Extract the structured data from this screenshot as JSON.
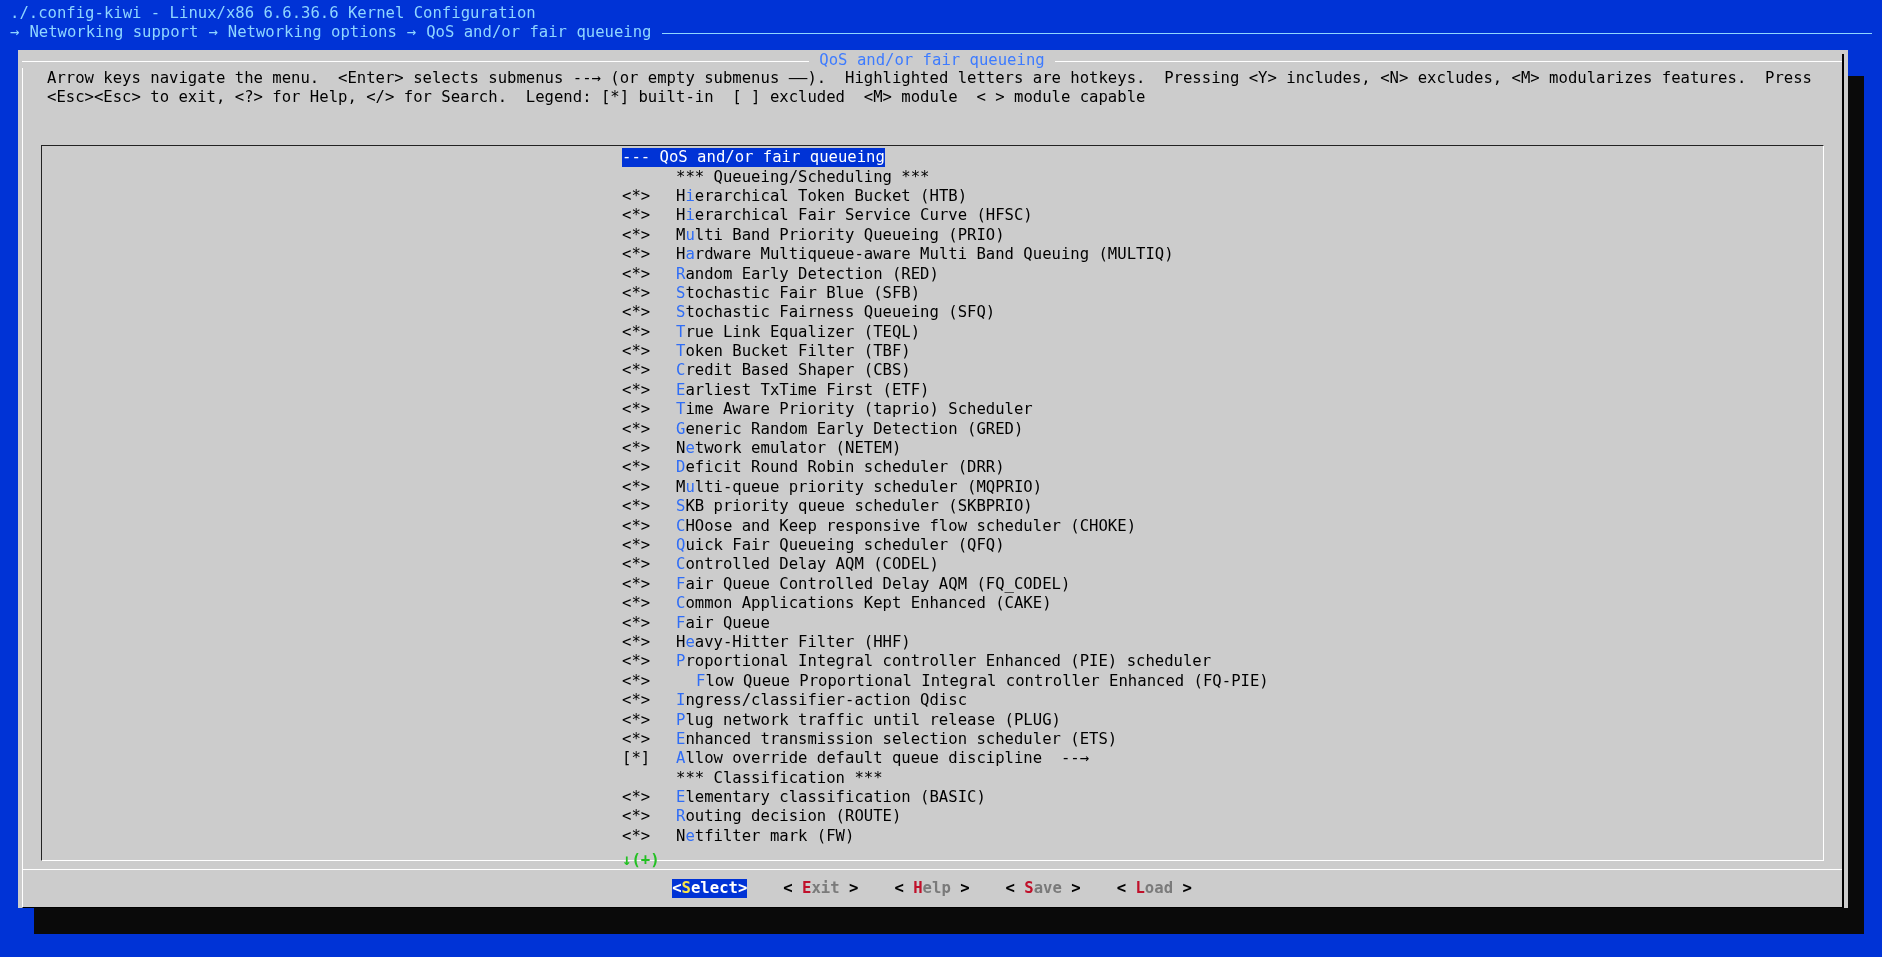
{
  "window": {
    "title": "./.config-kiwi - Linux/x86 6.6.36.6 Kernel Configuration"
  },
  "breadcrumb": {
    "separator": "→",
    "items": [
      "Networking support",
      "Networking options",
      "QoS and/or fair queueing"
    ]
  },
  "dialog": {
    "title": "QoS and/or fair queueing",
    "help": [
      "Arrow keys navigate the menu.  <Enter> selects submenus --→ (or empty submenus ——).  Highlighted letters are hotkeys.  Pressing <Y> includes, <N> excludes, <M> modularizes features.  Press",
      "<Esc><Esc> to exit, <?> for Help, </> for Search.  Legend: [*] built-in  [ ] excluded  <M> module  < > module capable"
    ],
    "items": [
      {
        "kind": "header",
        "text": "--- QoS and/or fair queueing",
        "selected": true
      },
      {
        "kind": "comment",
        "text": "*** Queueing/Scheduling ***",
        "selected": false
      },
      {
        "kind": "option",
        "status": "<*>",
        "pre": "H",
        "key": "i",
        "rest": "erarchical Token Bucket (HTB)",
        "selected": false
      },
      {
        "kind": "option",
        "status": "<*>",
        "pre": "H",
        "key": "i",
        "rest": "erarchical Fair Service Curve (HFSC)",
        "selected": false
      },
      {
        "kind": "option",
        "status": "<*>",
        "pre": "M",
        "key": "u",
        "rest": "lti Band Priority Queueing (PRIO)",
        "selected": false
      },
      {
        "kind": "option",
        "status": "<*>",
        "pre": "H",
        "key": "a",
        "rest": "rdware Multiqueue-aware Multi Band Queuing (MULTIQ)",
        "selected": false
      },
      {
        "kind": "option",
        "status": "<*>",
        "key": "R",
        "rest": "andom Early Detection (RED)",
        "selected": false
      },
      {
        "kind": "option",
        "status": "<*>",
        "key": "S",
        "rest": "tochastic Fair Blue (SFB)",
        "selected": false
      },
      {
        "kind": "option",
        "status": "<*>",
        "key": "S",
        "rest": "tochastic Fairness Queueing (SFQ)",
        "selected": false
      },
      {
        "kind": "option",
        "status": "<*>",
        "key": "T",
        "rest": "rue Link Equalizer (TEQL)",
        "selected": false
      },
      {
        "kind": "option",
        "status": "<*>",
        "key": "T",
        "rest": "oken Bucket Filter (TBF)",
        "selected": false
      },
      {
        "kind": "option",
        "status": "<*>",
        "key": "C",
        "rest": "redit Based Shaper (CBS)",
        "selected": false
      },
      {
        "kind": "option",
        "status": "<*>",
        "key": "E",
        "rest": "arliest TxTime First (ETF)",
        "selected": false
      },
      {
        "kind": "option",
        "status": "<*>",
        "key": "T",
        "rest": "ime Aware Priority (taprio) Scheduler",
        "selected": false
      },
      {
        "kind": "option",
        "status": "<*>",
        "key": "G",
        "rest": "eneric Random Early Detection (GRED)",
        "selected": false
      },
      {
        "kind": "option",
        "status": "<*>",
        "pre": "N",
        "key": "e",
        "rest": "twork emulator (NETEM)",
        "selected": false
      },
      {
        "kind": "option",
        "status": "<*>",
        "key": "D",
        "rest": "eficit Round Robin scheduler (DRR)",
        "selected": false
      },
      {
        "kind": "option",
        "status": "<*>",
        "pre": "M",
        "key": "u",
        "rest": "lti-queue priority scheduler (MQPRIO)",
        "selected": false
      },
      {
        "kind": "option",
        "status": "<*>",
        "key": "S",
        "rest": "KB priority queue scheduler (SKBPRIO)",
        "selected": false
      },
      {
        "kind": "option",
        "status": "<*>",
        "key": "C",
        "rest": "HOose and Keep responsive flow scheduler (CHOKE)",
        "selected": false
      },
      {
        "kind": "option",
        "status": "<*>",
        "key": "Q",
        "rest": "uick Fair Queueing scheduler (QFQ)",
        "selected": false
      },
      {
        "kind": "option",
        "status": "<*>",
        "key": "C",
        "rest": "ontrolled Delay AQM (CODEL)",
        "selected": false
      },
      {
        "kind": "option",
        "status": "<*>",
        "key": "F",
        "rest": "air Queue Controlled Delay AQM (FQ_CODEL)",
        "selected": false
      },
      {
        "kind": "option",
        "status": "<*>",
        "key": "C",
        "rest": "ommon Applications Kept Enhanced (CAKE)",
        "selected": false
      },
      {
        "kind": "option",
        "status": "<*>",
        "key": "F",
        "rest": "air Queue",
        "selected": false
      },
      {
        "kind": "option",
        "status": "<*>",
        "pre": "H",
        "key": "e",
        "rest": "avy-Hitter Filter (HHF)",
        "selected": false
      },
      {
        "kind": "option",
        "status": "<*>",
        "key": "P",
        "rest": "roportional Integral controller Enhanced (PIE) scheduler",
        "selected": false,
        "children": [
          {
            "kind": "option",
            "status": "<*>",
            "key": "F",
            "rest": "low Queue Proportional Integral controller Enhanced (FQ-PIE)",
            "selected": false
          }
        ]
      },
      {
        "kind": "option",
        "status": "<*>",
        "key": "I",
        "rest": "ngress/classifier-action Qdisc",
        "selected": false
      },
      {
        "kind": "option",
        "status": "<*>",
        "key": "P",
        "rest": "lug network traffic until release (PLUG)",
        "selected": false
      },
      {
        "kind": "option",
        "status": "<*>",
        "key": "E",
        "rest": "nhanced transmission selection scheduler (ETS)",
        "selected": false
      },
      {
        "kind": "option",
        "status": "[*]",
        "key": "A",
        "rest": "llow override default queue discipline  --→",
        "selected": false
      },
      {
        "kind": "comment",
        "text": "*** Classification ***",
        "selected": false
      },
      {
        "kind": "option",
        "status": "<*>",
        "key": "E",
        "rest": "lementary classification (BASIC)",
        "selected": false
      },
      {
        "kind": "option",
        "status": "<*>",
        "key": "R",
        "rest": "outing decision (ROUTE)",
        "selected": false
      },
      {
        "kind": "option",
        "status": "<*>",
        "pre": "N",
        "key": "e",
        "rest": "tfilter mark (FW)",
        "selected": false
      }
    ],
    "more": "↓(+)",
    "buttons": [
      {
        "left": "<",
        "key": "S",
        "rest": "elect",
        "right": ">",
        "selected": true
      },
      {
        "left": "< ",
        "key": "E",
        "rest": "xit",
        "right": " >",
        "selected": false
      },
      {
        "left": "< ",
        "key": "H",
        "rest": "elp",
        "right": " >",
        "selected": false
      },
      {
        "left": "< ",
        "key": "S",
        "rest": "ave",
        "right": " >",
        "selected": false
      },
      {
        "left": "< ",
        "key": "L",
        "rest": "oad",
        "right": " >",
        "selected": false
      }
    ]
  }
}
